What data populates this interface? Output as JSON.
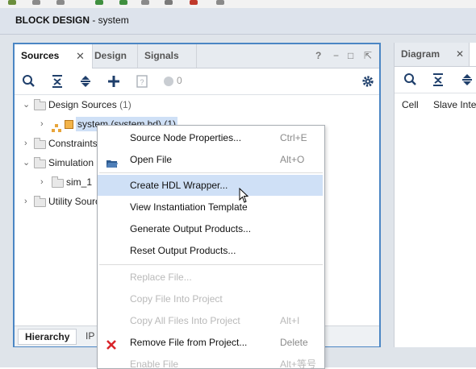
{
  "window": {
    "title_bold": "BLOCK DESIGN",
    "title_rest": " - system"
  },
  "sources_panel": {
    "tabs": [
      {
        "label": "Sources"
      },
      {
        "label": "Design"
      },
      {
        "label": "Signals"
      }
    ],
    "controls": {
      "help": "?",
      "minimize": "−",
      "maximize": "□",
      "float": "⇱"
    },
    "toolbar": {
      "badge_count": "0"
    },
    "tree": [
      {
        "label": "Design Sources",
        "count": "(1)"
      },
      {
        "label": "system (system.bd) (1)"
      },
      {
        "label": "Constraints"
      },
      {
        "label": "Simulation"
      },
      {
        "label": "sim_1"
      },
      {
        "label": "Utility Sourc"
      }
    ],
    "bottom_tabs": [
      {
        "label": "Hierarchy"
      },
      {
        "label": "IP"
      }
    ]
  },
  "diagram_panel": {
    "tab_label": "Diagram",
    "col_cell": "Cell",
    "col_slave": "Slave Inte"
  },
  "context_menu": {
    "items": [
      {
        "label": "Source Node Properties...",
        "shortcut": "Ctrl+E"
      },
      {
        "label": "Open File",
        "shortcut": "Alt+O"
      },
      {
        "label": "Create HDL Wrapper...",
        "shortcut": ""
      },
      {
        "label": "View Instantiation Template",
        "shortcut": ""
      },
      {
        "label": "Generate Output Products...",
        "shortcut": ""
      },
      {
        "label": "Reset Output Products...",
        "shortcut": ""
      },
      {
        "label": "Replace File...",
        "shortcut": ""
      },
      {
        "label": "Copy File Into Project",
        "shortcut": ""
      },
      {
        "label": "Copy All Files Into Project",
        "shortcut": "Alt+I"
      },
      {
        "label": "Remove File from Project...",
        "shortcut": "Delete"
      },
      {
        "label": "Enable File",
        "shortcut": "Alt+等号"
      }
    ]
  },
  "colors": {
    "accent": "#4b86c4",
    "menu_highlight": "#cfe0f6",
    "remove_icon": "#d9252a"
  }
}
